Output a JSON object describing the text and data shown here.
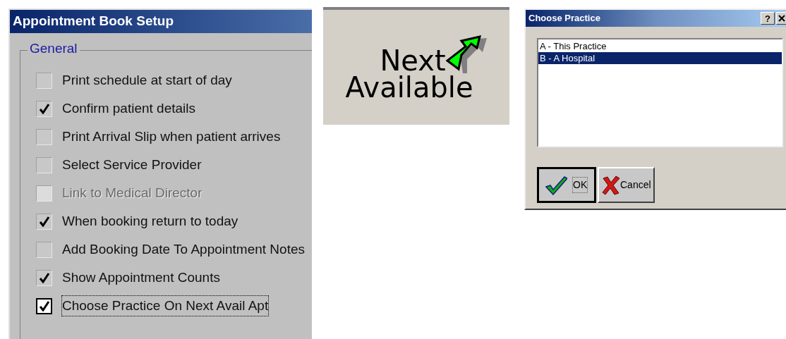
{
  "setup_window": {
    "title": "Appointment Book Setup",
    "group": {
      "label": "General",
      "options": [
        {
          "label": "Print schedule at start of day",
          "checked": false,
          "disabled": false,
          "focused": false
        },
        {
          "label": "Confirm patient details",
          "checked": true,
          "disabled": false,
          "focused": false
        },
        {
          "label": "Print Arrival Slip when patient arrives",
          "checked": false,
          "disabled": false,
          "focused": false
        },
        {
          "label": "Select Service Provider",
          "checked": false,
          "disabled": false,
          "focused": false
        },
        {
          "label": "Link to Medical Director",
          "checked": false,
          "disabled": true,
          "focused": false
        },
        {
          "label": "When booking return to today",
          "checked": true,
          "disabled": false,
          "focused": false
        },
        {
          "label": "Add Booking Date To Appointment Notes",
          "checked": false,
          "disabled": false,
          "focused": false
        },
        {
          "label": "Show Appointment Counts",
          "checked": true,
          "disabled": false,
          "focused": false
        },
        {
          "label": "Choose Practice On Next Avail Apt",
          "checked": true,
          "disabled": false,
          "focused": true
        }
      ]
    }
  },
  "toolbar_button": {
    "lines": [
      "Next",
      "Available"
    ]
  },
  "dialog": {
    "title": "Choose Practice",
    "help": "?",
    "items": [
      {
        "label": "A - This Practice",
        "selected": false
      },
      {
        "label": "B - A Hospital",
        "selected": true
      }
    ],
    "buttons": [
      {
        "label": "OK",
        "kind": "ok",
        "default": true
      },
      {
        "label": "Cancel",
        "kind": "cancel",
        "default": false
      }
    ]
  }
}
